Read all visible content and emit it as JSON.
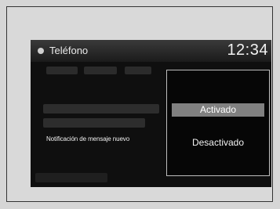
{
  "header": {
    "title": "Teléfono",
    "clock": "12:34",
    "phone_icon": "phone-icon"
  },
  "menu": {
    "visible_item": "Notificación de mensaje nuevo"
  },
  "popup": {
    "options": [
      {
        "label": "Activado",
        "selected": true
      },
      {
        "label": "Desactivado",
        "selected": false
      }
    ]
  }
}
